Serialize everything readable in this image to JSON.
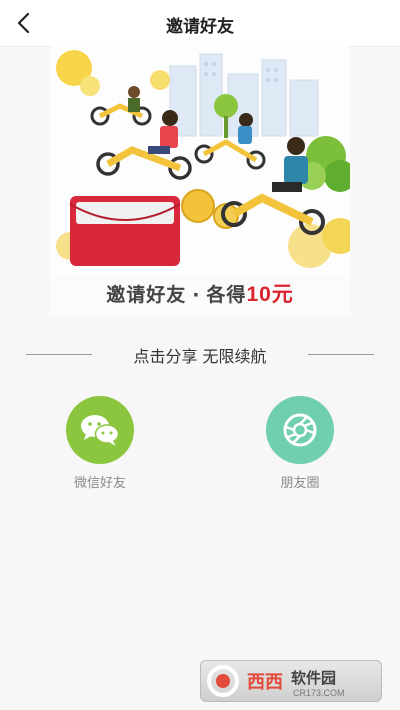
{
  "nav": {
    "title": "邀请好友"
  },
  "banner": {
    "caption_main": "邀请好友",
    "caption_dot": "·",
    "caption_prefix": "各得",
    "caption_amount": "10元"
  },
  "share": {
    "heading": "点击分享 无限续航",
    "options": [
      {
        "label": "微信好友",
        "color": "#8cc63f",
        "icon": "wechat-icon"
      },
      {
        "label": "朋友圈",
        "color": "#6fcfae",
        "icon": "moments-icon"
      }
    ]
  },
  "watermark": {
    "brand": "西西软件园",
    "url": "CR173.COM"
  }
}
